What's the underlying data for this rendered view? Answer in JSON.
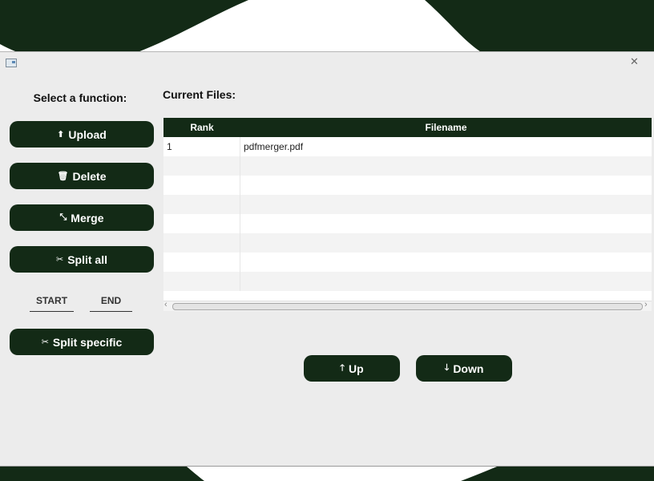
{
  "window": {
    "title": ""
  },
  "sidebar": {
    "title": "Select a function:",
    "buttons": [
      {
        "label": "Upload",
        "icon": "⬆"
      },
      {
        "label": "Delete",
        "icon": "🗑"
      },
      {
        "label": "Merge",
        "icon": "⤡"
      },
      {
        "label": "Split all",
        "icon": "✂"
      }
    ],
    "range": {
      "start_placeholder": "START",
      "end_placeholder": "END"
    },
    "split_specific": {
      "label": "Split specific",
      "icon": "✂"
    }
  },
  "files": {
    "title": "Current Files:",
    "columns": [
      "Rank",
      "Filename"
    ],
    "rows": [
      {
        "rank": "1",
        "filename": "pdfmerger.pdf"
      }
    ]
  },
  "move": {
    "up": {
      "label": "Up",
      "icon": "🡑"
    },
    "down": {
      "label": "Down",
      "icon": "🡓"
    }
  },
  "colors": {
    "accent": "#132a16",
    "window_bg": "#ececec"
  }
}
